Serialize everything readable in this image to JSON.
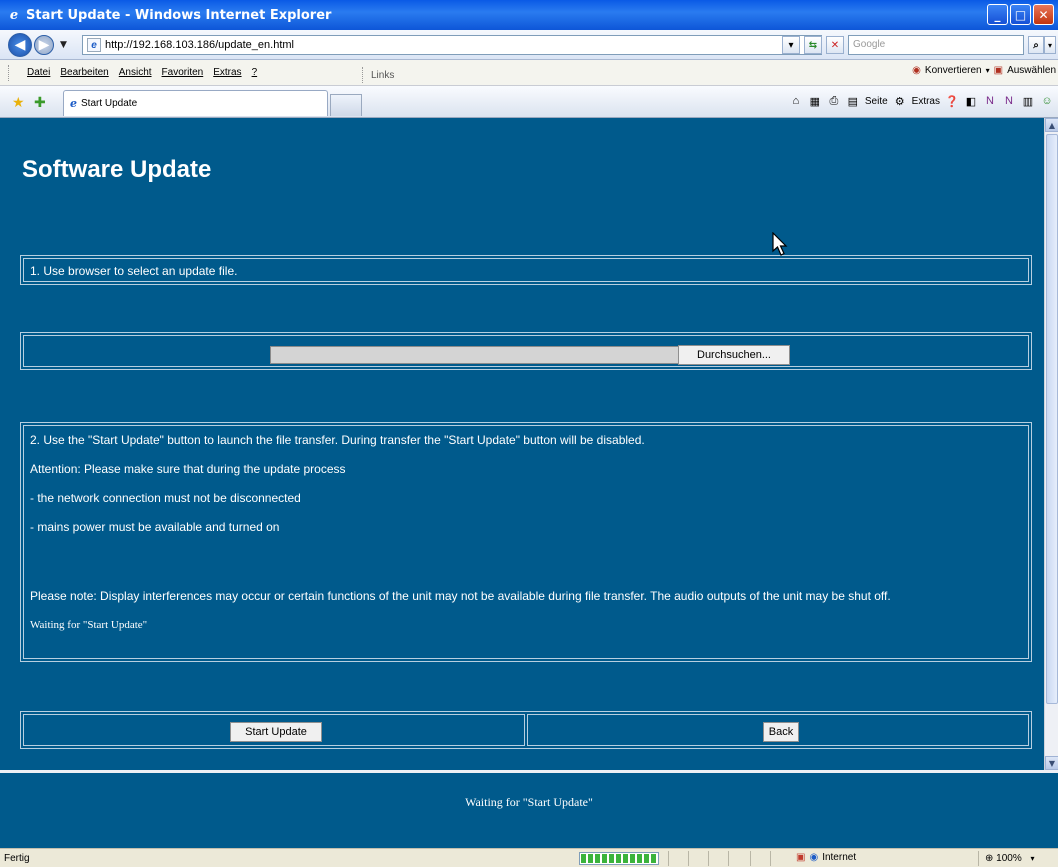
{
  "window": {
    "title": "Start Update - Windows Internet Explorer",
    "minimize": "_",
    "maximize": "□",
    "close": "✕"
  },
  "address": {
    "url": "http://192.168.103.186/update_en.html",
    "search_placeholder": "Google"
  },
  "menu": {
    "items": [
      "Datei",
      "Bearbeiten",
      "Ansicht",
      "Favoriten",
      "Extras",
      "?"
    ],
    "links_label": "Links",
    "convert_label": "Konvertieren",
    "select_label": "Auswählen"
  },
  "tabs": {
    "active_tab": "Start Update"
  },
  "commandbar": {
    "page_label": "Seite",
    "tools_label": "Extras"
  },
  "page": {
    "heading": "Software Update",
    "step1": "1. Use browser to select an update file.",
    "browse_label": "Durchsuchen...",
    "info_lines": [
      "2. Use the \"Start Update\" button to launch the file transfer. During transfer the \"Start Update\" button will be disabled.",
      "Attention: Please make sure that during the update process",
      "- the network connection must not be disconnected",
      "- mains power must be available and turned on",
      "Please note: Display interferences may occur or certain functions of the unit may not be available during file transfer. The audio outputs of the unit may be shut off."
    ],
    "waiting_status": "Waiting for \"Start Update\"",
    "start_update_label": "Start Update",
    "back_label": "Back",
    "footer_status": "Waiting for \"Start Update\""
  },
  "statusbar": {
    "text": "Fertig",
    "zone": "Internet",
    "zoom": "100%"
  }
}
